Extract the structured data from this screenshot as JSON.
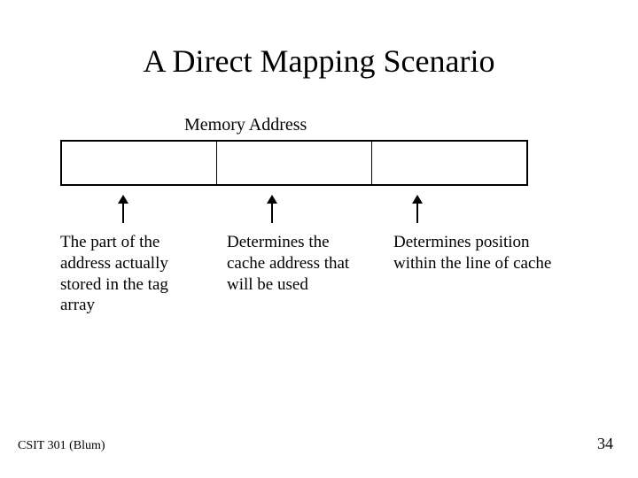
{
  "slide": {
    "title": "A Direct Mapping Scenario",
    "subtitle": "Memory Address",
    "descriptions": {
      "tag": "The part of the address actually stored in the tag array",
      "line": "Determines the cache address that will be used",
      "word": "Determines position within the line of cache"
    },
    "footer": {
      "course": "CSIT 301 (Blum)",
      "page": "34"
    }
  }
}
